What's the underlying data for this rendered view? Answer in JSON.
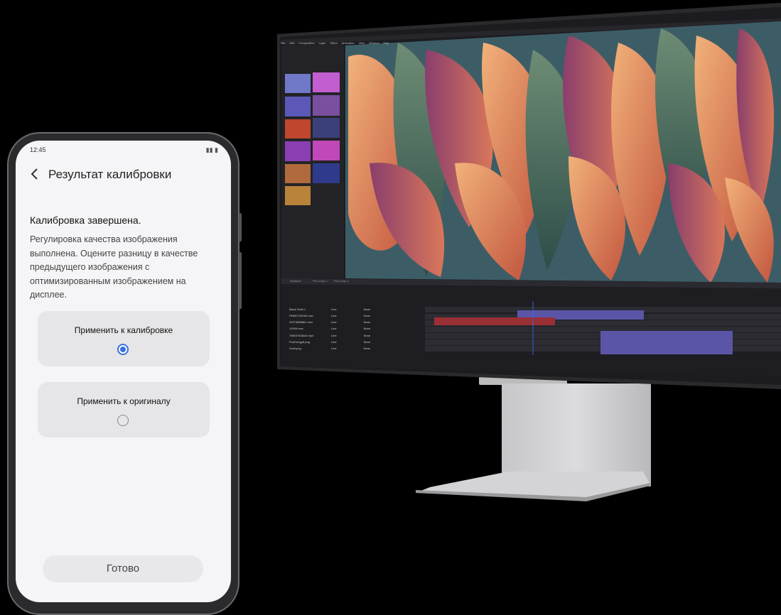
{
  "phone": {
    "status_time": "12:45",
    "status_icons": "▮▮ ▮",
    "title": "Результат калибровки",
    "heading": "Калибровка завершена.",
    "description": "Регулировка качества изображения выполнена. Оцените разницу в качестве предыдущего изображения с оптимизированным изображением на дисплее.",
    "options": [
      {
        "label": "Применить к калибровке",
        "selected": true
      },
      {
        "label": "Применить к оригиналу",
        "selected": false
      }
    ],
    "done_label": "Готово"
  },
  "monitor": {
    "menu": [
      "File",
      "Edit",
      "Composition",
      "Layer",
      "Effect",
      "Animation",
      "View",
      "Window",
      "Help"
    ],
    "tabs": [
      "Spotlane",
      "Pre-comp 1",
      "Pre-comp 2"
    ],
    "layers": [
      "Black Solid 1",
      "PMM27420A2.mov",
      "20074686861.mov",
      "12005.mov",
      "756047628ol3.mp4",
      "ProEnergy8.png",
      "Solid.png"
    ],
    "layer_mode": "Line",
    "layer_trkmat": "None",
    "colors": {
      "track_purple": "#5b55a8",
      "track_red": "#9a2f35",
      "bg_app": "#1e1e22"
    }
  }
}
